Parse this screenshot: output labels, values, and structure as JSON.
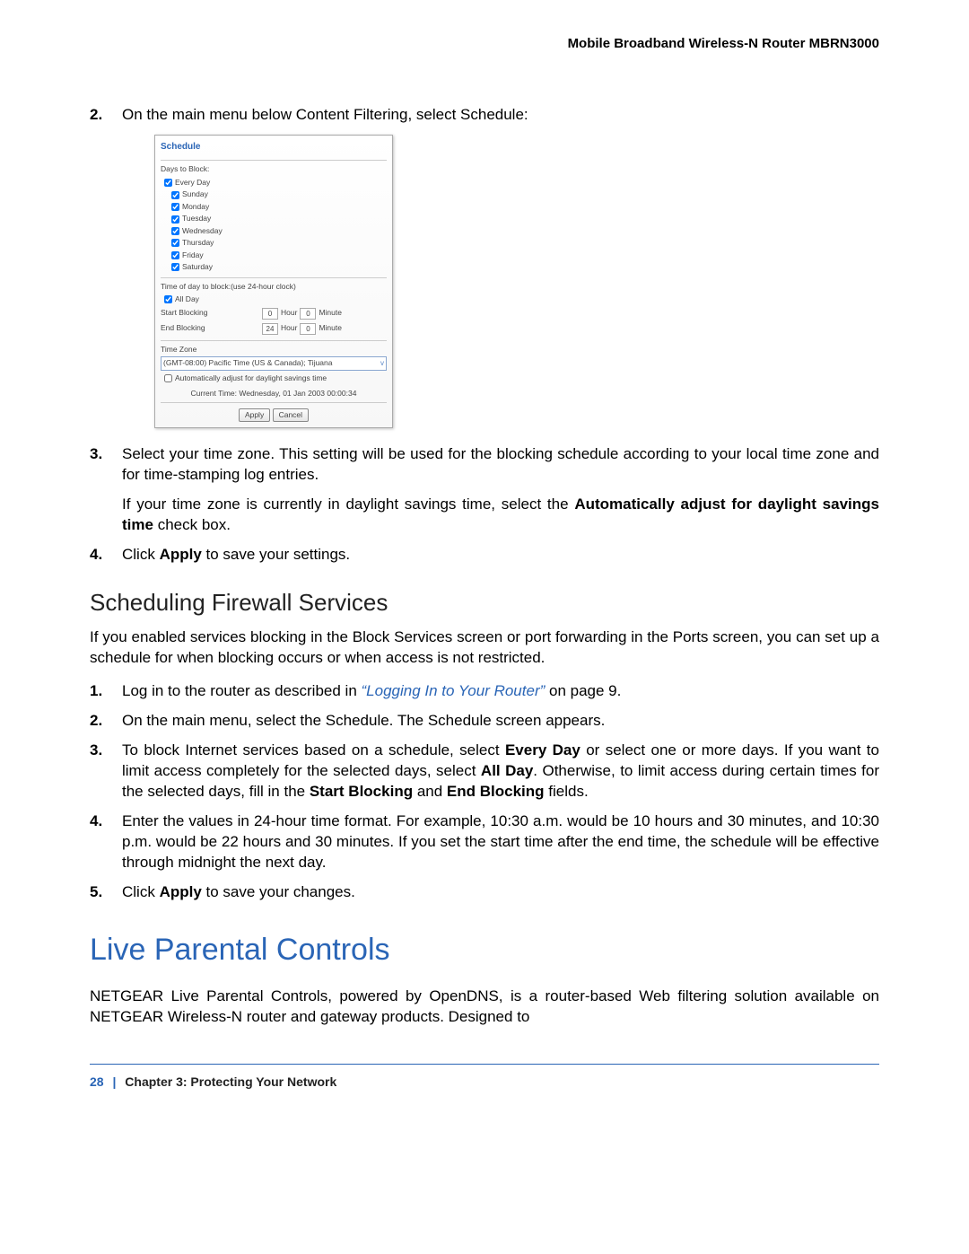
{
  "header": {
    "doc_title": "Mobile Broadband Wireless-N Router MBRN3000"
  },
  "steps_top": {
    "s2": "On the main menu below Content Filtering, select Schedule:",
    "s3_p1": "Select your time zone. This setting will be used for the blocking schedule according to your local time zone and for time-stamping log entries.",
    "s3_p2": {
      "pre": "If your time zone is currently in daylight savings time, select the ",
      "bold": "Automatically adjust for daylight savings time",
      "post": " check box."
    },
    "s4": {
      "pre": "Click ",
      "bold": "Apply",
      "post": " to save your settings."
    }
  },
  "screenshot": {
    "title": "Schedule",
    "days_label": "Days to Block:",
    "every_day": "Every Day",
    "days": [
      "Sunday",
      "Monday",
      "Tuesday",
      "Wednesday",
      "Thursday",
      "Friday",
      "Saturday"
    ],
    "time_label": "Time of day to block:(use 24-hour clock)",
    "all_day": "All Day",
    "start_label": "Start Blocking",
    "end_label": "End Blocking",
    "hour": "Hour",
    "minute": "Minute",
    "start_hour_val": "0",
    "start_min_val": "0",
    "end_hour_val": "24",
    "end_min_val": "0",
    "tz_label": "Time Zone",
    "tz_value": "(GMT-08:00) Pacific Time (US & Canada); Tijuana",
    "dst_cb": "Automatically adjust for daylight savings time",
    "current_time": "Current Time:  Wednesday, 01 Jan 2003 00:00:34",
    "apply": "Apply",
    "cancel": "Cancel"
  },
  "section2": {
    "heading": "Scheduling Firewall Services",
    "intro": "If you enabled services blocking in the Block Services screen or port forwarding in the Ports screen, you can set up a schedule for when blocking occurs or when access is not restricted.",
    "s1": {
      "pre": "Log in to the router as described in ",
      "link": "“Logging In to Your Router”",
      "post": " on page 9."
    },
    "s2": "On the main menu, select the Schedule. The Schedule screen appears.",
    "s3": {
      "pre": "To block Internet services based on a schedule, select ",
      "b1": "Every Day",
      "mid1": " or select one or more days. If you want to limit access completely for the selected days, select ",
      "b2": "All Day",
      "mid2": ". Otherwise, to limit access during certain times for the selected days, fill in the ",
      "b3": "Start Blocking",
      "mid3": " and ",
      "b4": "End Blocking",
      "post": " fields."
    },
    "s4": "Enter the values in 24-hour time format. For example, 10:30 a.m. would be 10 hours and 30 minutes, and 10:30 p.m. would be 22 hours and 30 minutes. If you set the start time after the end time, the schedule will be effective through midnight the next day.",
    "s5": {
      "pre": "Click ",
      "bold": "Apply",
      "post": " to save your changes."
    }
  },
  "major": {
    "heading": "Live Parental Controls",
    "para": "NETGEAR Live Parental Controls, powered by OpenDNS, is a router-based Web filtering solution available on NETGEAR Wireless-N router and gateway products. Designed to"
  },
  "footer": {
    "page": "28",
    "divider": "|",
    "chapter": "Chapter 3:  Protecting Your Network"
  }
}
